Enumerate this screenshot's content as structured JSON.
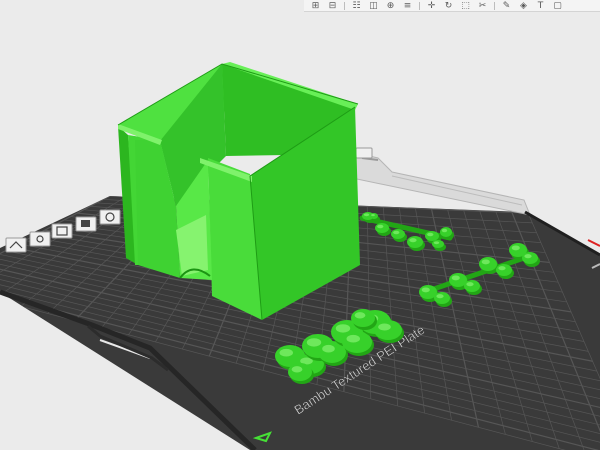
{
  "app": {
    "screen": "3D printing slicer – Prepare view"
  },
  "toolbar": {
    "items": [
      {
        "icon": "add-object-icon",
        "glyph": "⊞"
      },
      {
        "icon": "add-plate-icon",
        "glyph": "⊟"
      },
      {
        "icon": "arrange-icon",
        "glyph": "☷"
      },
      {
        "icon": "orient-icon",
        "glyph": "◫"
      },
      {
        "icon": "split-icon",
        "glyph": "⊕"
      },
      {
        "icon": "layers-icon",
        "glyph": "≡"
      },
      {
        "icon": "move-icon",
        "glyph": "✛"
      },
      {
        "icon": "rotate-icon",
        "glyph": "↻"
      },
      {
        "icon": "scale-icon",
        "glyph": "⬚"
      },
      {
        "icon": "cut-icon",
        "glyph": "✂"
      },
      {
        "icon": "support-paint-icon",
        "glyph": "✎"
      },
      {
        "icon": "seam-paint-icon",
        "glyph": "◈"
      },
      {
        "icon": "text-icon",
        "glyph": "T"
      },
      {
        "icon": "measure-icon",
        "glyph": "▢"
      }
    ]
  },
  "plate": {
    "label": "Bambu Textured PEI Plate",
    "colors": {
      "bed": "#3a3a3a",
      "grid": "#565656",
      "edge": "#262626",
      "model": "#37d12a",
      "model_dark": "#22a615",
      "model_light": "#6ee85c"
    }
  },
  "plate_tools": {
    "icons": [
      "lock-plate-icon",
      "plate-arrange-icon",
      "plate-orient-icon",
      "plate-settings-icon",
      "plate-delete-icon",
      "plate-name-icon"
    ]
  }
}
